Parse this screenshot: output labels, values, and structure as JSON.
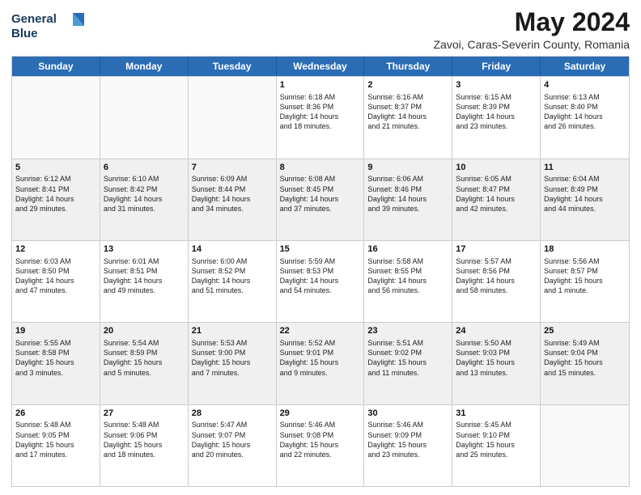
{
  "header": {
    "logo_line1": "General",
    "logo_line2": "Blue",
    "main_title": "May 2024",
    "subtitle": "Zavoi, Caras-Severin County, Romania"
  },
  "calendar": {
    "days_of_week": [
      "Sunday",
      "Monday",
      "Tuesday",
      "Wednesday",
      "Thursday",
      "Friday",
      "Saturday"
    ],
    "rows": [
      [
        {
          "day": "",
          "text": ""
        },
        {
          "day": "",
          "text": ""
        },
        {
          "day": "",
          "text": ""
        },
        {
          "day": "1",
          "text": "Sunrise: 6:18 AM\nSunset: 8:36 PM\nDaylight: 14 hours\nand 18 minutes."
        },
        {
          "day": "2",
          "text": "Sunrise: 6:16 AM\nSunset: 8:37 PM\nDaylight: 14 hours\nand 21 minutes."
        },
        {
          "day": "3",
          "text": "Sunrise: 6:15 AM\nSunset: 8:39 PM\nDaylight: 14 hours\nand 23 minutes."
        },
        {
          "day": "4",
          "text": "Sunrise: 6:13 AM\nSunset: 8:40 PM\nDaylight: 14 hours\nand 26 minutes."
        }
      ],
      [
        {
          "day": "5",
          "text": "Sunrise: 6:12 AM\nSunset: 8:41 PM\nDaylight: 14 hours\nand 29 minutes."
        },
        {
          "day": "6",
          "text": "Sunrise: 6:10 AM\nSunset: 8:42 PM\nDaylight: 14 hours\nand 31 minutes."
        },
        {
          "day": "7",
          "text": "Sunrise: 6:09 AM\nSunset: 8:44 PM\nDaylight: 14 hours\nand 34 minutes."
        },
        {
          "day": "8",
          "text": "Sunrise: 6:08 AM\nSunset: 8:45 PM\nDaylight: 14 hours\nand 37 minutes."
        },
        {
          "day": "9",
          "text": "Sunrise: 6:06 AM\nSunset: 8:46 PM\nDaylight: 14 hours\nand 39 minutes."
        },
        {
          "day": "10",
          "text": "Sunrise: 6:05 AM\nSunset: 8:47 PM\nDaylight: 14 hours\nand 42 minutes."
        },
        {
          "day": "11",
          "text": "Sunrise: 6:04 AM\nSunset: 8:49 PM\nDaylight: 14 hours\nand 44 minutes."
        }
      ],
      [
        {
          "day": "12",
          "text": "Sunrise: 6:03 AM\nSunset: 8:50 PM\nDaylight: 14 hours\nand 47 minutes."
        },
        {
          "day": "13",
          "text": "Sunrise: 6:01 AM\nSunset: 8:51 PM\nDaylight: 14 hours\nand 49 minutes."
        },
        {
          "day": "14",
          "text": "Sunrise: 6:00 AM\nSunset: 8:52 PM\nDaylight: 14 hours\nand 51 minutes."
        },
        {
          "day": "15",
          "text": "Sunrise: 5:59 AM\nSunset: 8:53 PM\nDaylight: 14 hours\nand 54 minutes."
        },
        {
          "day": "16",
          "text": "Sunrise: 5:58 AM\nSunset: 8:55 PM\nDaylight: 14 hours\nand 56 minutes."
        },
        {
          "day": "17",
          "text": "Sunrise: 5:57 AM\nSunset: 8:56 PM\nDaylight: 14 hours\nand 58 minutes."
        },
        {
          "day": "18",
          "text": "Sunrise: 5:56 AM\nSunset: 8:57 PM\nDaylight: 15 hours\nand 1 minute."
        }
      ],
      [
        {
          "day": "19",
          "text": "Sunrise: 5:55 AM\nSunset: 8:58 PM\nDaylight: 15 hours\nand 3 minutes."
        },
        {
          "day": "20",
          "text": "Sunrise: 5:54 AM\nSunset: 8:59 PM\nDaylight: 15 hours\nand 5 minutes."
        },
        {
          "day": "21",
          "text": "Sunrise: 5:53 AM\nSunset: 9:00 PM\nDaylight: 15 hours\nand 7 minutes."
        },
        {
          "day": "22",
          "text": "Sunrise: 5:52 AM\nSunset: 9:01 PM\nDaylight: 15 hours\nand 9 minutes."
        },
        {
          "day": "23",
          "text": "Sunrise: 5:51 AM\nSunset: 9:02 PM\nDaylight: 15 hours\nand 11 minutes."
        },
        {
          "day": "24",
          "text": "Sunrise: 5:50 AM\nSunset: 9:03 PM\nDaylight: 15 hours\nand 13 minutes."
        },
        {
          "day": "25",
          "text": "Sunrise: 5:49 AM\nSunset: 9:04 PM\nDaylight: 15 hours\nand 15 minutes."
        }
      ],
      [
        {
          "day": "26",
          "text": "Sunrise: 5:48 AM\nSunset: 9:05 PM\nDaylight: 15 hours\nand 17 minutes."
        },
        {
          "day": "27",
          "text": "Sunrise: 5:48 AM\nSunset: 9:06 PM\nDaylight: 15 hours\nand 18 minutes."
        },
        {
          "day": "28",
          "text": "Sunrise: 5:47 AM\nSunset: 9:07 PM\nDaylight: 15 hours\nand 20 minutes."
        },
        {
          "day": "29",
          "text": "Sunrise: 5:46 AM\nSunset: 9:08 PM\nDaylight: 15 hours\nand 22 minutes."
        },
        {
          "day": "30",
          "text": "Sunrise: 5:46 AM\nSunset: 9:09 PM\nDaylight: 15 hours\nand 23 minutes."
        },
        {
          "day": "31",
          "text": "Sunrise: 5:45 AM\nSunset: 9:10 PM\nDaylight: 15 hours\nand 25 minutes."
        },
        {
          "day": "",
          "text": ""
        }
      ]
    ]
  }
}
